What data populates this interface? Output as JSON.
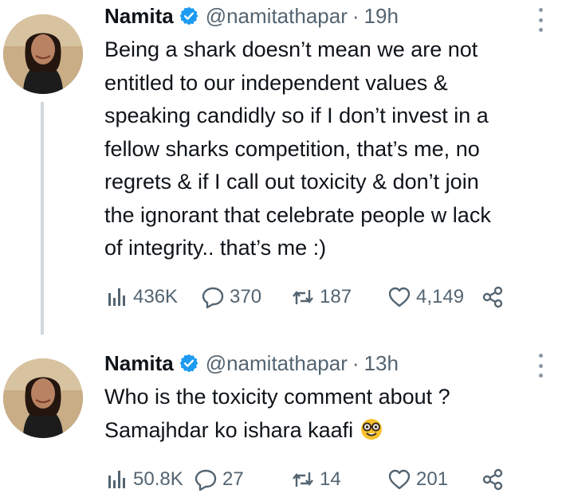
{
  "tweets": [
    {
      "author_name": "Namita",
      "handle": "@namitathapar",
      "separator": "·",
      "time": "19h",
      "lines": [
        "Being a shark doesn’t mean we are not",
        "entitled to our independent values &",
        "speaking candidly so if I don’t invest in a",
        "fellow sharks competition, that’s me, no",
        "regrets & if I call out toxicity & don’t join",
        "the ignorant that celebrate people w lack",
        "of integrity.. that’s me :)"
      ],
      "views": "436K",
      "replies": "370",
      "retweets": "187",
      "likes": "4,149"
    },
    {
      "author_name": "Namita",
      "handle": "@namitathapar",
      "separator": "·",
      "time": "13h",
      "lines": [
        "Who is the toxicity comment about ?",
        "Samajhdar ko ishara kaafi"
      ],
      "views": "50.8K",
      "replies": "27",
      "retweets": "14",
      "likes": "201"
    }
  ],
  "icons": {
    "views": "analytics-icon",
    "reply": "reply-icon",
    "retweet": "retweet-icon",
    "like": "heart-icon",
    "share": "share-icon",
    "verified": "verified-badge-icon",
    "more": "more-options-icon",
    "emoji": "nerd-face-emoji"
  },
  "colors": {
    "verified": "#1d9bf0",
    "secondary_text": "#536471",
    "primary_text": "#0f1419",
    "thread_line": "#cfd9de"
  }
}
